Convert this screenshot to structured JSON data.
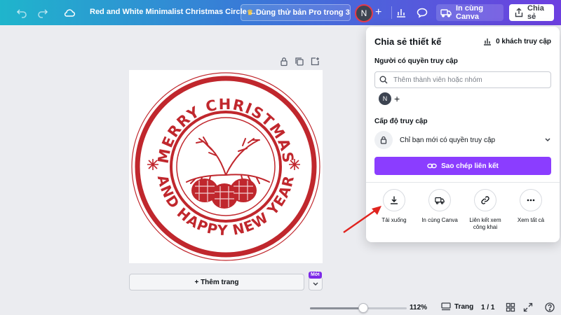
{
  "topbar": {
    "doc_title": "Red and White Minimalist Christmas Circle ...",
    "pro_label": "Dùng thử bản Pro trong 3...",
    "avatar_initial": "N",
    "print_label": "In cùng Canva",
    "share_label": "Chia sẻ",
    "icons": [
      "undo-icon",
      "redo-icon",
      "cloud-icon",
      "plus-icon",
      "chart-icon",
      "comment-icon",
      "truck-icon",
      "share-icon"
    ],
    "accent_gradient": [
      "#1fb5cc",
      "#6d3fe0"
    ]
  },
  "design": {
    "stamp_top_text": "MERRY CHRISTMAS",
    "stamp_bottom_text": "AND HAPPY NEW YEAR",
    "stamp_color": "#c0272d"
  },
  "canvas": {
    "add_page_label": "+ Thêm trang",
    "new_badge": "Mới"
  },
  "bottombar": {
    "zoom_label": "112%",
    "zoom_fraction": 0.55,
    "pages_label": "Trang",
    "page_count": "1 / 1"
  },
  "share_panel": {
    "title": "Chia sẻ thiết kế",
    "visitors": "0 khách truy cập",
    "access_people_label": "Người có quyền truy cập",
    "search_placeholder": "Thêm thành viên hoặc nhóm",
    "member_initial": "N",
    "access_level_label": "Cấp độ truy cập",
    "access_value": "Chỉ bạn mới có quyền truy cập",
    "copy_link_label": "Sao chép liên kết",
    "primary_color": "#8b3dff",
    "actions": [
      {
        "label": "Tải xuống",
        "icon": "download-icon"
      },
      {
        "label": "In cùng Canva",
        "icon": "truck-icon"
      },
      {
        "label": "Liên kết xem công khai",
        "icon": "link-icon"
      },
      {
        "label": "Xem tất cả",
        "icon": "more-icon"
      }
    ]
  }
}
